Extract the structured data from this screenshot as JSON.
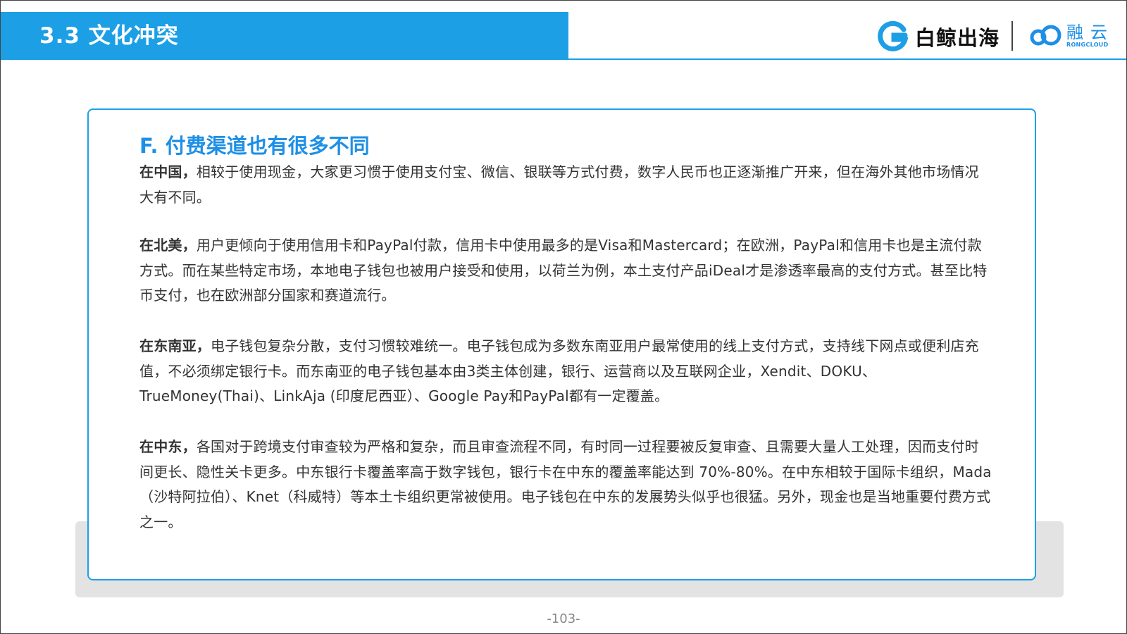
{
  "header": {
    "section_title": "3.3 文化冲突",
    "brand_baijing": "白鲸出海",
    "brand_rongyun_cn": "融云",
    "brand_rongyun_en": "RONGCLOUD",
    "accent_color": "#1d9fe6"
  },
  "card": {
    "heading": "F. 付费渠道也有很多不同",
    "paragraphs": [
      {
        "lead": "在中国，",
        "body": "相较于使用现金，大家更习惯于使用支付宝、微信、银联等方式付费，数字人民币也正逐渐推广开来，但在海外其他市场情况大有不同。"
      },
      {
        "lead": "在北美，",
        "body": "用户更倾向于使用信用卡和PayPal付款，信用卡中使用最多的是Visa和Mastercard；在欧洲，PayPal和信用卡也是主流付款方式。而在某些特定市场，本地电子钱包也被用户接受和使用，以荷兰为例，本土支付产品iDeal才是渗透率最高的支付方式。甚至比特币支付，也在欧洲部分国家和赛道流行。"
      },
      {
        "lead": "在东南亚，",
        "body": "电子钱包复杂分散，支付习惯较难统一。电子钱包成为多数东南亚用户最常使用的线上支付方式，支持线下网点或便利店充值，不必须绑定银行卡。而东南亚的电子钱包基本由3类主体创建，银行、运营商以及互联网企业，Xendit、DOKU、TrueMoney(Thai)、LinkAja (印度尼西亚）、Google Pay和PayPal都有一定覆盖。"
      },
      {
        "lead": "在中东，",
        "body": "各国对于跨境支付审查较为严格和复杂，而且审查流程不同，有时同一过程要被反复审查、且需要大量人工处理，因而支付时间更长、隐性关卡更多。中东银行卡覆盖率高于数字钱包，银行卡在中东的覆盖率能达到 70%-80%。在中东相较于国际卡组织，Mada（沙特阿拉伯）、Knet（科威特）等本土卡组织更常被使用。电子钱包在中东的发展势头似乎也很猛。另外，现金也是当地重要付费方式之一。"
      }
    ]
  },
  "footer": {
    "page_number": "-103-"
  }
}
